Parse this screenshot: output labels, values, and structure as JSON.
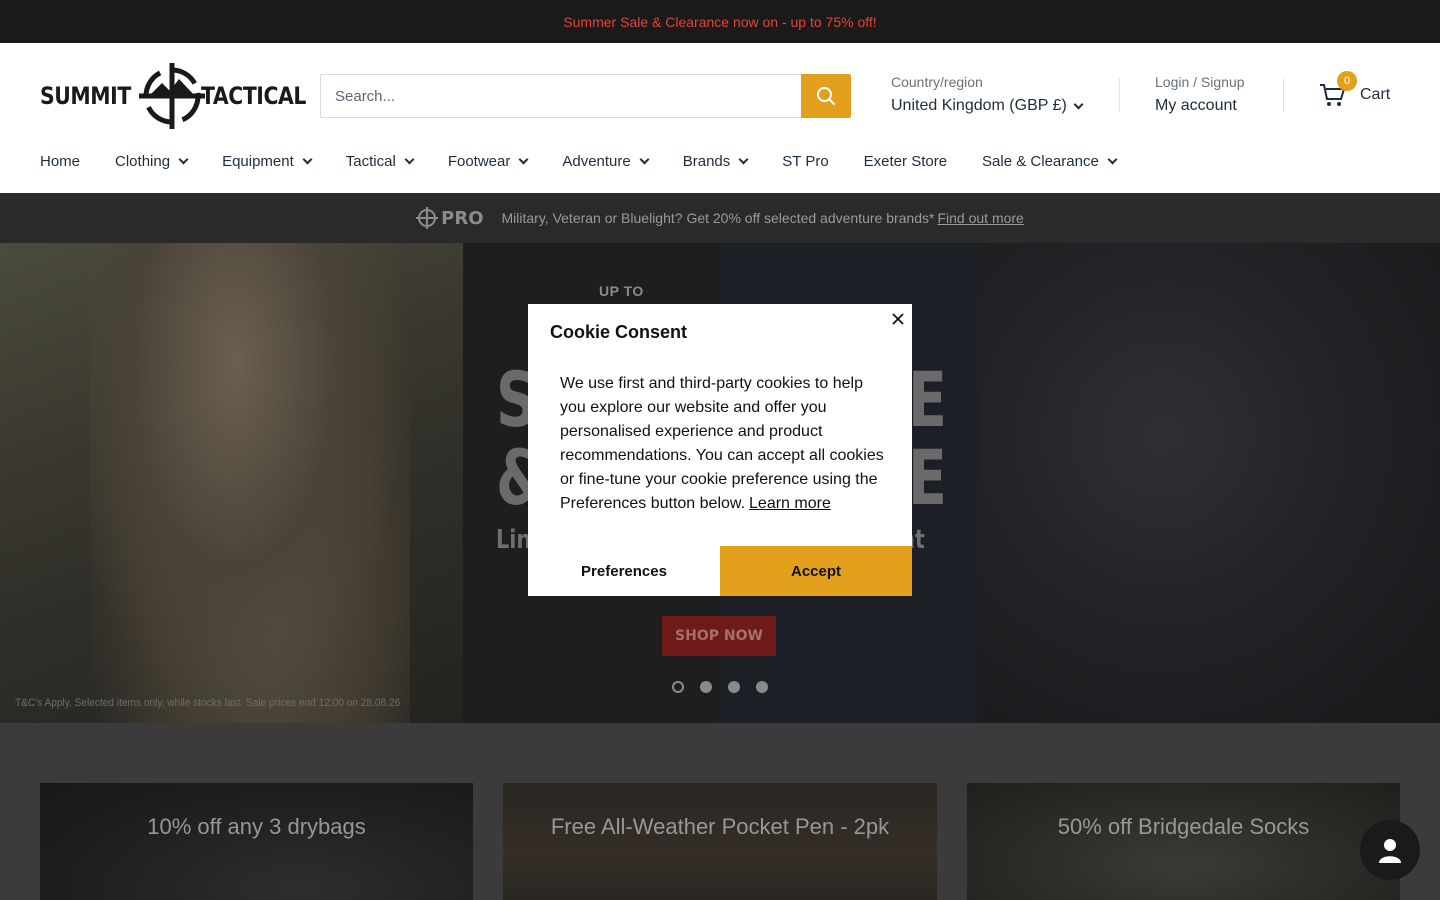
{
  "announcement": {
    "text": "Summer Sale & Clearance now on - up to 75% off!"
  },
  "header": {
    "logo": {
      "left": "SUMMIT",
      "right": "TACTICAL"
    },
    "search": {
      "placeholder": "Search..."
    },
    "region": {
      "label": "Country/region",
      "value": "United Kingdom (GBP £)"
    },
    "account": {
      "label": "Login / Signup",
      "value": "My account"
    },
    "cart": {
      "count": "0",
      "label": "Cart"
    }
  },
  "nav": {
    "items": [
      {
        "label": "Home",
        "dropdown": false
      },
      {
        "label": "Clothing",
        "dropdown": true
      },
      {
        "label": "Equipment",
        "dropdown": true
      },
      {
        "label": "Tactical",
        "dropdown": true
      },
      {
        "label": "Footwear",
        "dropdown": true
      },
      {
        "label": "Adventure",
        "dropdown": true
      },
      {
        "label": "Brands",
        "dropdown": true
      },
      {
        "label": "ST Pro",
        "dropdown": false
      },
      {
        "label": "Exeter Store",
        "dropdown": false
      },
      {
        "label": "Sale & Clearance",
        "dropdown": true
      }
    ]
  },
  "promo": {
    "badge": "PRO",
    "text": "Military, Veteran or Bluelight? Get 20% off selected adventure brands*",
    "link": "Find out more"
  },
  "hero": {
    "eyebrow": "UP TO",
    "line1_left": "S",
    "line1_right": "E",
    "line2_left": "&",
    "line2_right": "E",
    "sub_left": "Lin",
    "sub_right": "ent",
    "cta": "SHOP NOW",
    "terms": "T&C's Apply. Selected items only, while stocks last. Sale prices end 12:00 on 28.08.26",
    "slides": 4,
    "active_slide": 1
  },
  "cards": [
    {
      "label": "10% off any 3 drybags"
    },
    {
      "label": "Free All-Weather Pocket Pen - 2pk"
    },
    {
      "label": "50% off Bridgedale Socks"
    }
  ],
  "cookie": {
    "title": "Cookie Consent",
    "body": "We use first and third-party cookies to help you explore our website and offer you personalised experience and product recommendations. You can accept all cookies or fine-tune your cookie preference using the Preferences button below.",
    "learn_more": "Learn more",
    "preferences": "Preferences",
    "accept": "Accept"
  },
  "colors": {
    "accent": "#e3a01c",
    "sale_red": "#e0443a",
    "dark": "#1a1a1a"
  },
  "icons": [
    "search-icon",
    "chevron-down-icon",
    "cart-icon",
    "close-icon",
    "user-icon",
    "crosshair-logo-icon"
  ]
}
